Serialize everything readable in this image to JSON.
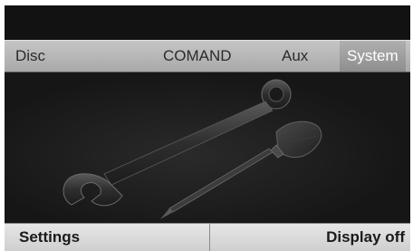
{
  "tabs": [
    {
      "label": "Disc",
      "active": false
    },
    {
      "label": "COMAND",
      "active": false
    },
    {
      "label": "Aux",
      "active": false
    },
    {
      "label": "System",
      "active": true
    }
  ],
  "content": {
    "icon": "wrench-and-screwdriver"
  },
  "softkeys": {
    "left_label": "Settings",
    "right_label": "Display off"
  },
  "colors": {
    "tabbar": "#b8b8b8",
    "active_tab_text": "#ffffff",
    "background": "#161616",
    "softkey_bar": "#dcdcdc"
  }
}
